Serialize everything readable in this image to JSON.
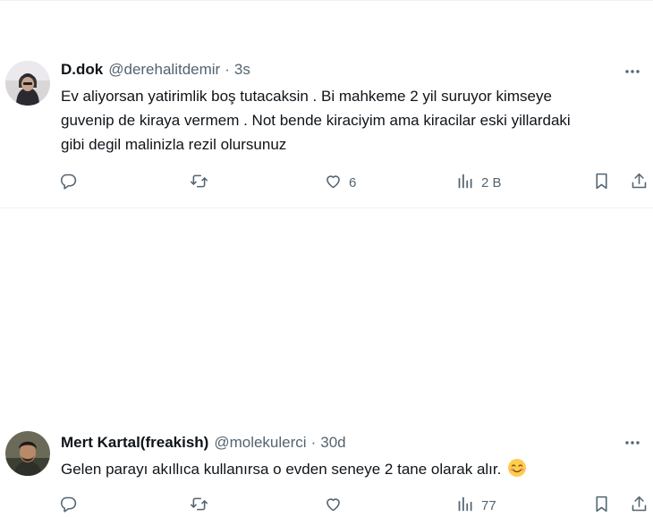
{
  "tweets": [
    {
      "display_name": "D.dok",
      "handle": "@derehalitdemir",
      "separator": "·",
      "time": "3s",
      "text_lines": [
        "Ev aliyorsan yatirimlik boş tutacaksin . Bi mahkeme 2 yil suruyor kimseye",
        "guvenip de kiraya vermem . Not bende kiraciyim ama kiracilar eski yillardaki",
        "gibi degil malinizla rezil olursunuz"
      ],
      "replies": "",
      "retweets": "",
      "likes": "6",
      "views": "2 B"
    },
    {
      "display_name": "Mert Kartal(freakish)",
      "handle": "@molekulerci",
      "separator": "·",
      "time": "30d",
      "text_lines": [
        "Gelen parayı akıllıca kullanırsa o evden seneye 2 tane olarak alır."
      ],
      "emoji": "smiling-face-emoji",
      "replies": "",
      "retweets": "",
      "likes": "",
      "views": "77"
    }
  ],
  "icons": {
    "more": "more-icon",
    "reply": "reply-icon",
    "retweet": "retweet-icon",
    "like": "like-icon",
    "views": "views-icon",
    "bookmark": "bookmark-icon",
    "share": "share-icon"
  },
  "colors": {
    "text": "#0f1419",
    "secondary": "#536471",
    "divider": "#eff3f4"
  }
}
